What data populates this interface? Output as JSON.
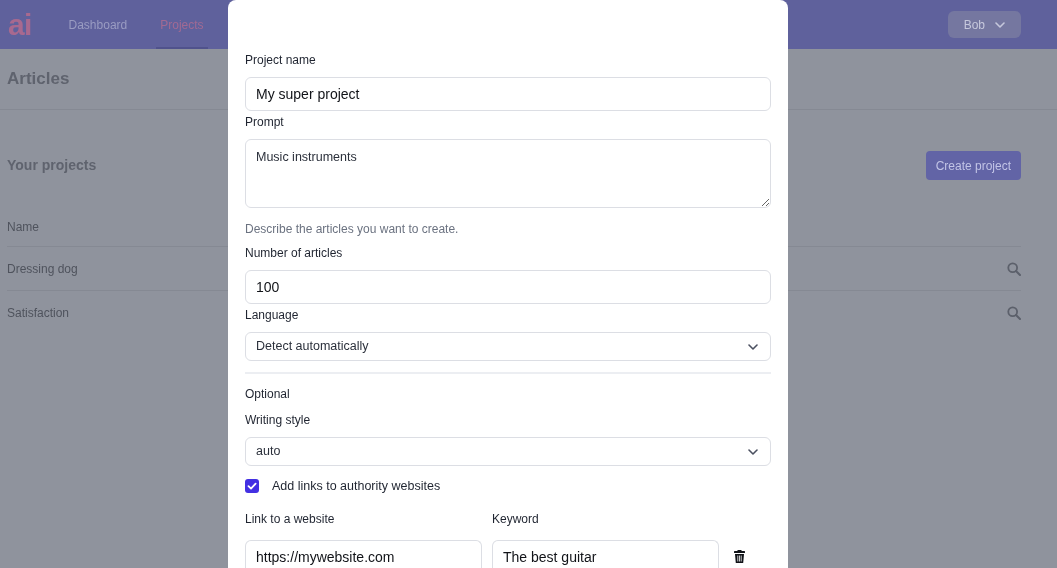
{
  "header": {
    "logo": "ai",
    "nav": [
      {
        "label": "Dashboard",
        "selected": false
      },
      {
        "label": "Projects",
        "selected": true
      }
    ],
    "user_menu": "Bob"
  },
  "page": {
    "title": "Articles",
    "section_title": "Your projects",
    "create_button": "Create project",
    "table": {
      "columns": [
        "Name"
      ],
      "rows": [
        {
          "name": "Dressing dog"
        },
        {
          "name": "Satisfaction"
        }
      ]
    }
  },
  "modal": {
    "items": [
      {
        "kind": "input",
        "label": "Project name",
        "value": "My super project"
      },
      {
        "kind": "textarea",
        "label": "Prompt",
        "value": "Music instruments",
        "help": "Describe the articles you want to create."
      },
      {
        "kind": "input",
        "label": "Number of articles",
        "value": "100"
      },
      {
        "kind": "select",
        "label": "Language",
        "value": "Detect automatically"
      },
      {
        "kind": "section",
        "title": "Optional"
      },
      {
        "kind": "select",
        "label": "Writing style",
        "value": "auto"
      },
      {
        "kind": "checkbox",
        "label": "Add links to authority websites",
        "checked": true
      },
      {
        "kind": "link_rows",
        "columns": [
          "Link to a website",
          "Keyword"
        ],
        "rows": [
          {
            "link": "https://mywebsite.com",
            "keyword": "The best guitar"
          }
        ]
      }
    ]
  }
}
